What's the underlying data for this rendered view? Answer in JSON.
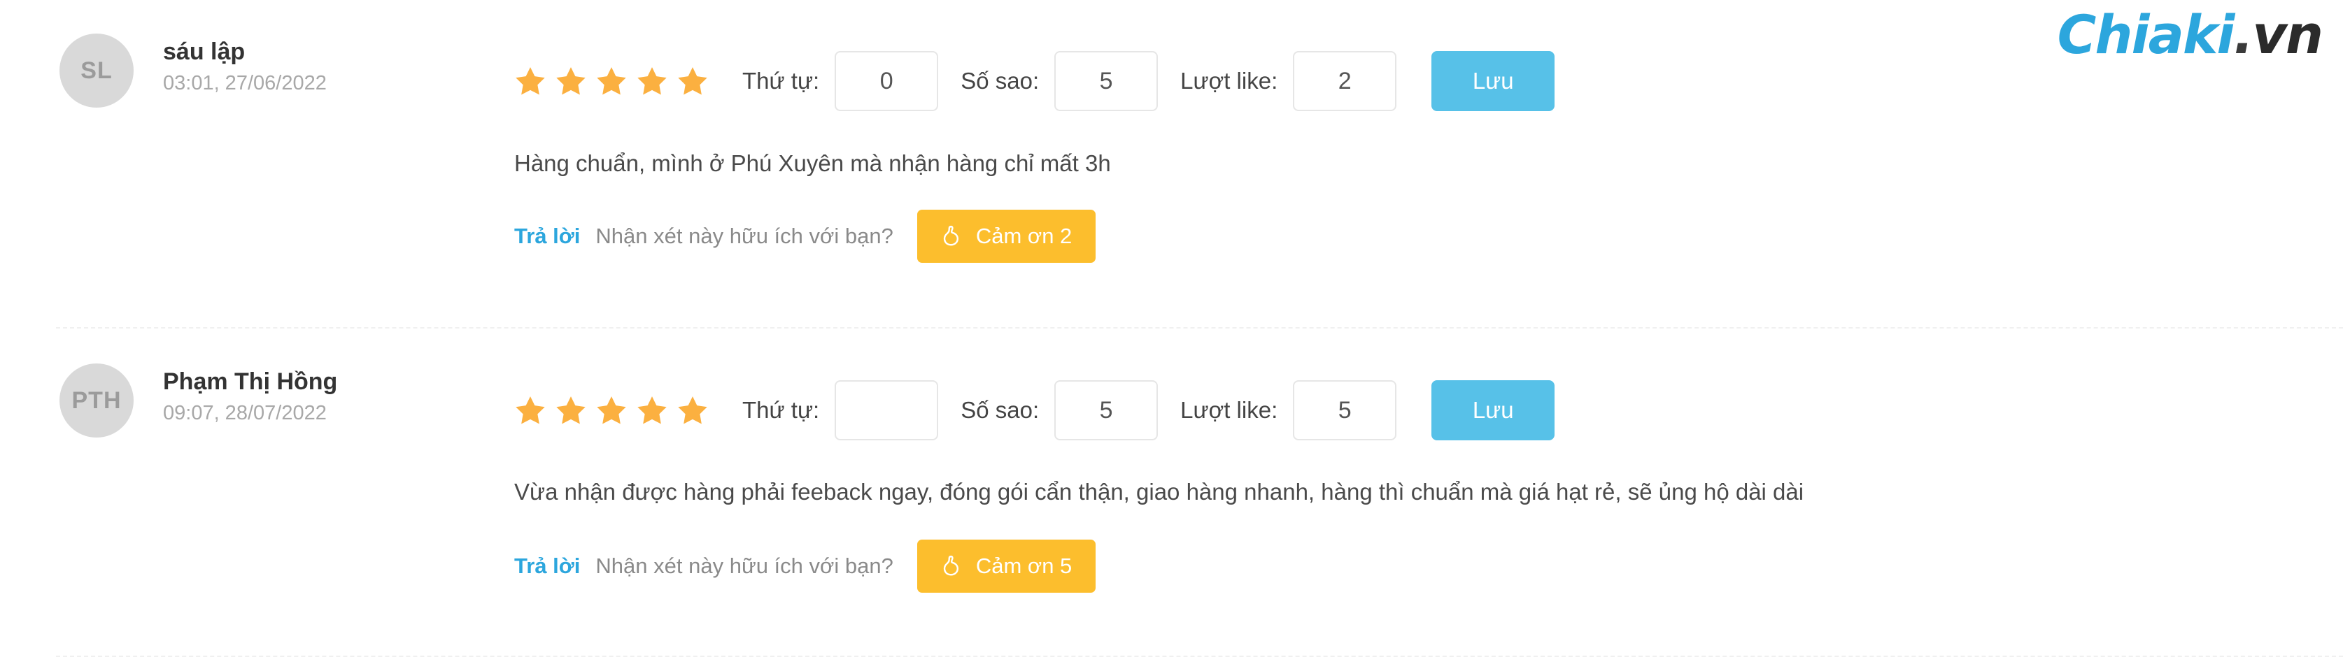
{
  "brand": {
    "name": "Chiaki",
    "dot": ".",
    "tld": "vn"
  },
  "labels": {
    "order_label": "Thứ tự:",
    "stars_label": "Số sao:",
    "likes_label": "Lượt like:",
    "save_label": "Lưu",
    "reply_label": "Trả lời",
    "helpful_label": "Nhận xét này hữu ích với bạn?",
    "thanks_prefix": "Cảm ơn"
  },
  "icons": {
    "star": "star-icon",
    "thumbs_up": "thumbs-up-icon"
  },
  "colors": {
    "star": "#fbb040",
    "save_button": "#57c1e8",
    "thanks_button": "#fcbe2d",
    "link": "#2ca6dd",
    "avatar_bg": "#d9d9d9",
    "brand_blue": "#2ca6dd"
  },
  "reviews": [
    {
      "avatar_initials": "SL",
      "author": "sáu lập",
      "date": "03:01, 27/06/2022",
      "rating": 5,
      "order_value": "0",
      "stars_value": "5",
      "likes_value": "2",
      "save_label": "Lưu",
      "text": "Hàng chuẩn, mình ở Phú Xuyên mà nhận hàng chỉ mất 3h",
      "reply_label": "Trả lời",
      "helpful_label": "Nhận xét này hữu ích với bạn?",
      "thanks_label": "Cảm ơn 2"
    },
    {
      "avatar_initials": "PTH",
      "author": "Phạm Thị Hồng",
      "date": "09:07, 28/07/2022",
      "rating": 5,
      "order_value": "",
      "stars_value": "5",
      "likes_value": "5",
      "save_label": "Lưu",
      "text": "Vừa nhận được hàng phải feeback ngay, đóng gói cẩn thận, giao hàng nhanh, hàng thì chuẩn mà giá hạt rẻ, sẽ ủng hộ dài dài",
      "reply_label": "Trả lời",
      "helpful_label": "Nhận xét này hữu ích với bạn?",
      "thanks_label": "Cảm ơn 5"
    }
  ]
}
